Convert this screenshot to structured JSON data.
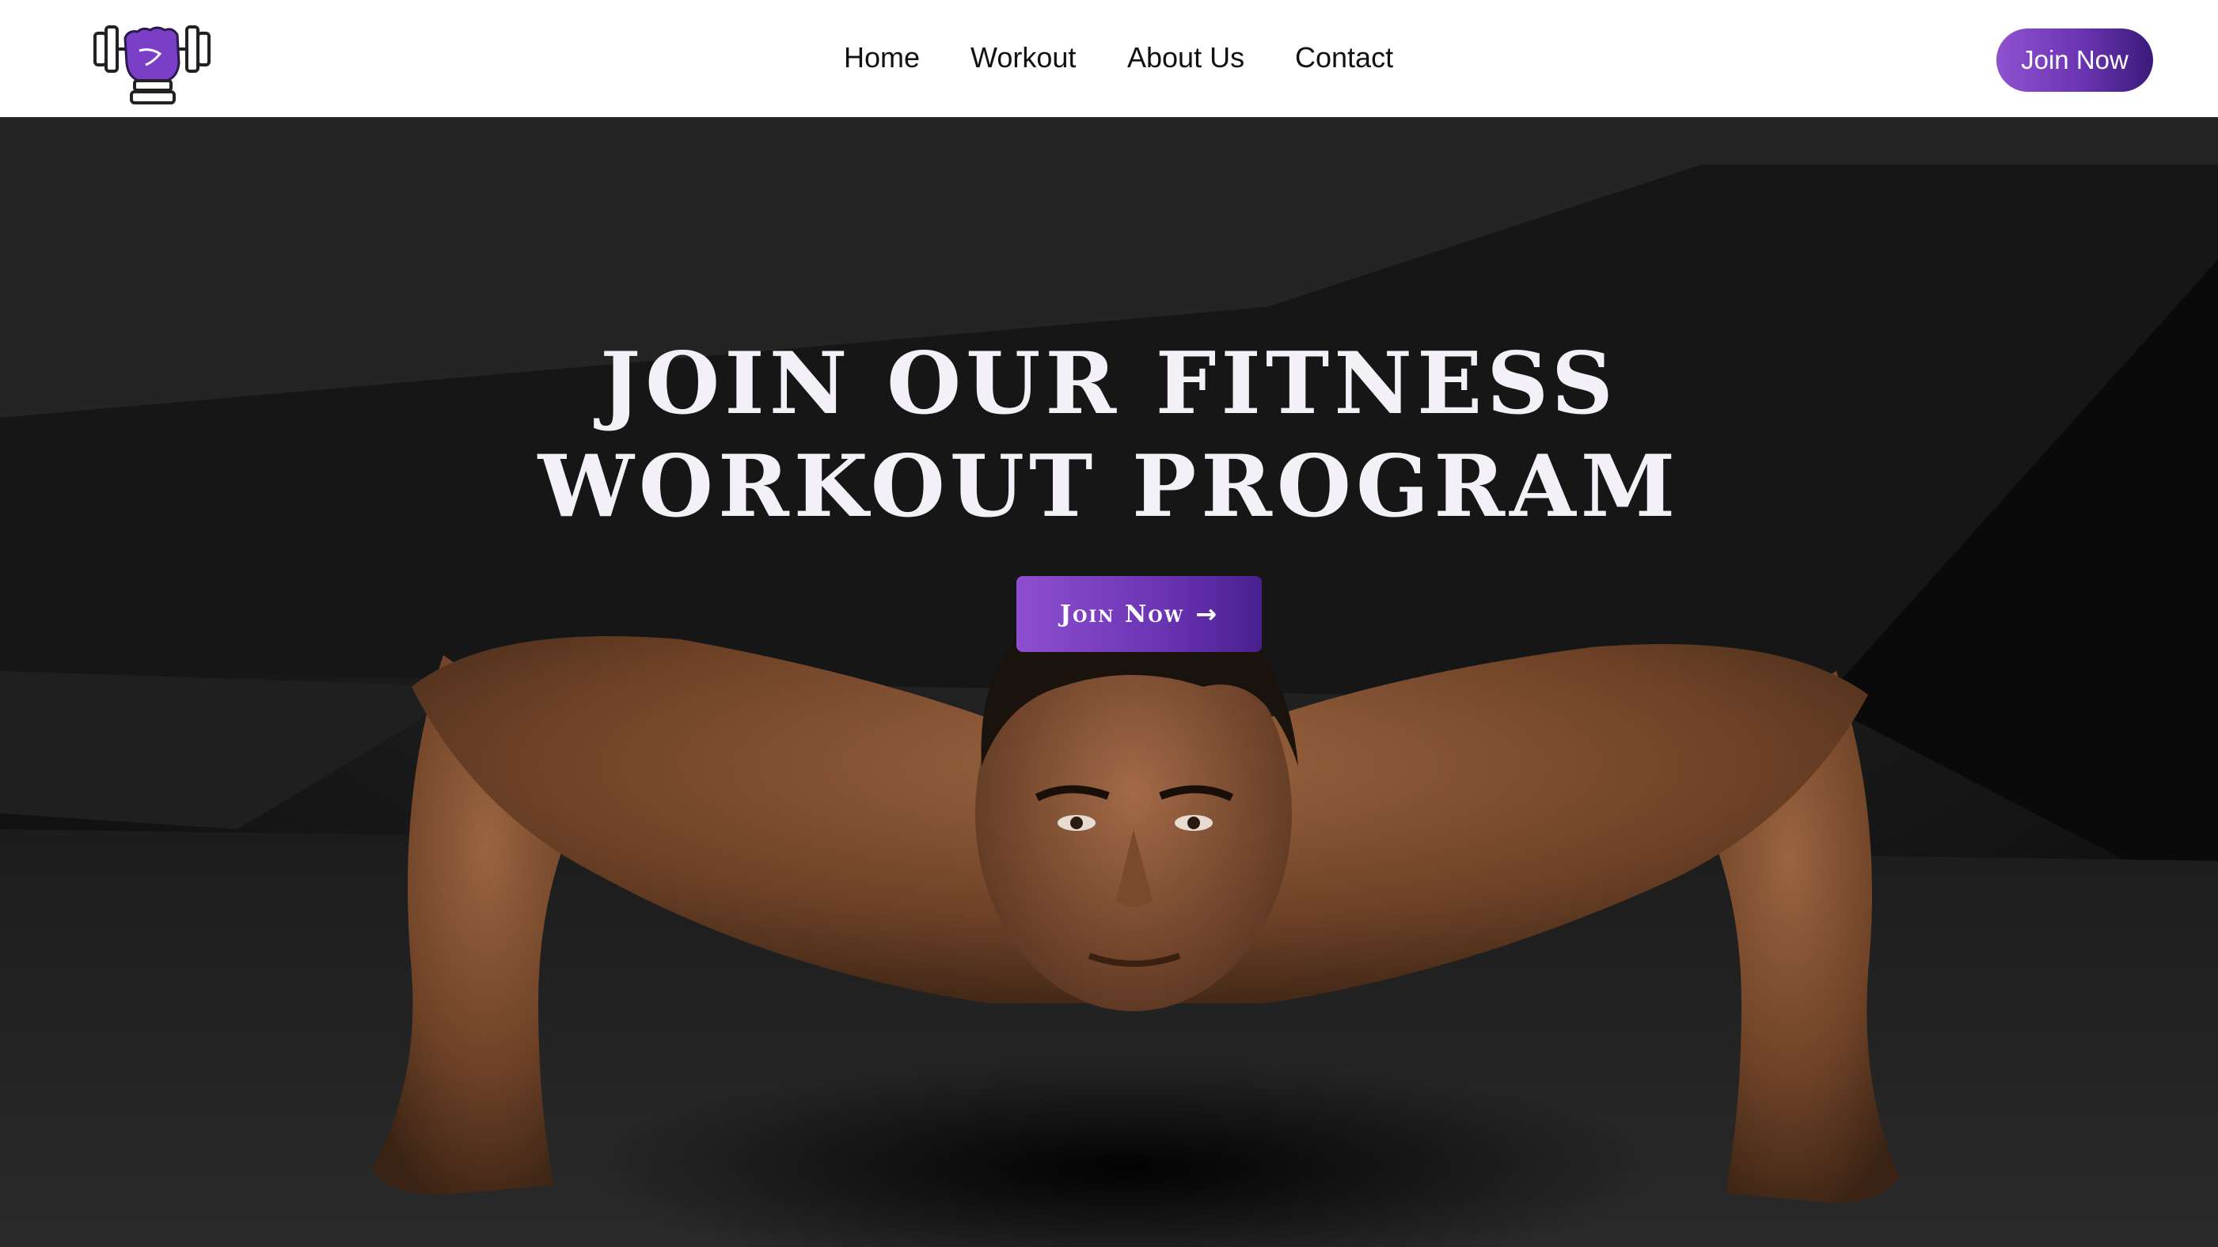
{
  "nav": {
    "links": [
      {
        "label": "Home"
      },
      {
        "label": "Workout"
      },
      {
        "label": "About Us"
      },
      {
        "label": "Contact"
      }
    ],
    "join_label": "Join Now"
  },
  "hero": {
    "title_line1": "JOIN OUR FITNESS",
    "title_line2": "WORKOUT PROGRAM",
    "cta_label": "Join Now",
    "cta_icon": "arrow-right-icon"
  },
  "theme": {
    "accent": "#7c3fc4",
    "accent_dark": "#3a1a78",
    "nav_bg": "#ffffff",
    "hero_bg": "#151515"
  },
  "logo": {
    "icon": "dumbbell-fist-logo-icon"
  }
}
